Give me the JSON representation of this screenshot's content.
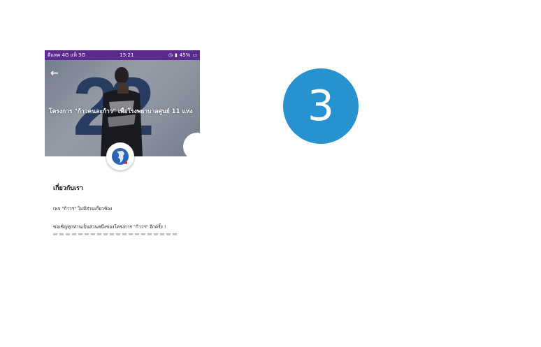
{
  "status_bar": {
    "carrier": "ดีแทค 4G แท็ 3G",
    "time": "15:21",
    "battery": "45%"
  },
  "hero": {
    "back_icon": "back-arrow-icon",
    "title": "โครงการ \"ก้าวคนละก้าว\" เพื่อโรงพยาบาลศูนย์ 11 แห่ง"
  },
  "about": {
    "heading": "เกี่ยวกับเรา",
    "line1": "เพจ \"ก้าวฯ\" ไม่มีส่วนเกี่ยวข้อง",
    "line2": "ขอเชิญทุกท่านเป็นส่วนหนึ่งของโครงการ \"ก้าวฯ\" อีกครั้ง !"
  },
  "step_badge": {
    "number": "3",
    "color": "#2692cf"
  },
  "colors": {
    "status_bar": "#5a2a8c",
    "hero_digits": "#2f4a78"
  }
}
